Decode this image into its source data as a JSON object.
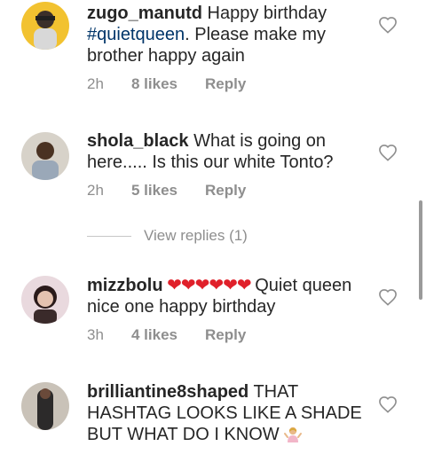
{
  "comments": [
    {
      "username": "zugo_manutd",
      "text_before": " Happy birthday ",
      "hashtag": "#quietqueen",
      "text_after": ". Please make my brother happy again",
      "time": "2h",
      "likes": "8 likes",
      "reply": "Reply"
    },
    {
      "username": "shola_black",
      "text": " What is going on here..... Is this our white Tonto?",
      "time": "2h",
      "likes": "5 likes",
      "reply": "Reply"
    },
    {
      "username": "mizzbolu",
      "hearts": " ❤❤❤❤❤❤ ",
      "text": "Quiet queen nice one happy birthday",
      "time": "3h",
      "likes": "4 likes",
      "reply": "Reply"
    },
    {
      "username": "brilliantine8shaped",
      "text": " THAT HASHTAG LOOKS LIKE A SHADE BUT WHAT DO I KNOW"
    }
  ],
  "view_replies": "View replies (1)",
  "icons": {
    "like": "heart-outline-icon",
    "shrug": "person-shrugging-emoji"
  },
  "colors": {
    "text": "#262626",
    "meta": "#8e8e8e",
    "hashtag": "#003569",
    "heart_red": "#e0202a"
  }
}
